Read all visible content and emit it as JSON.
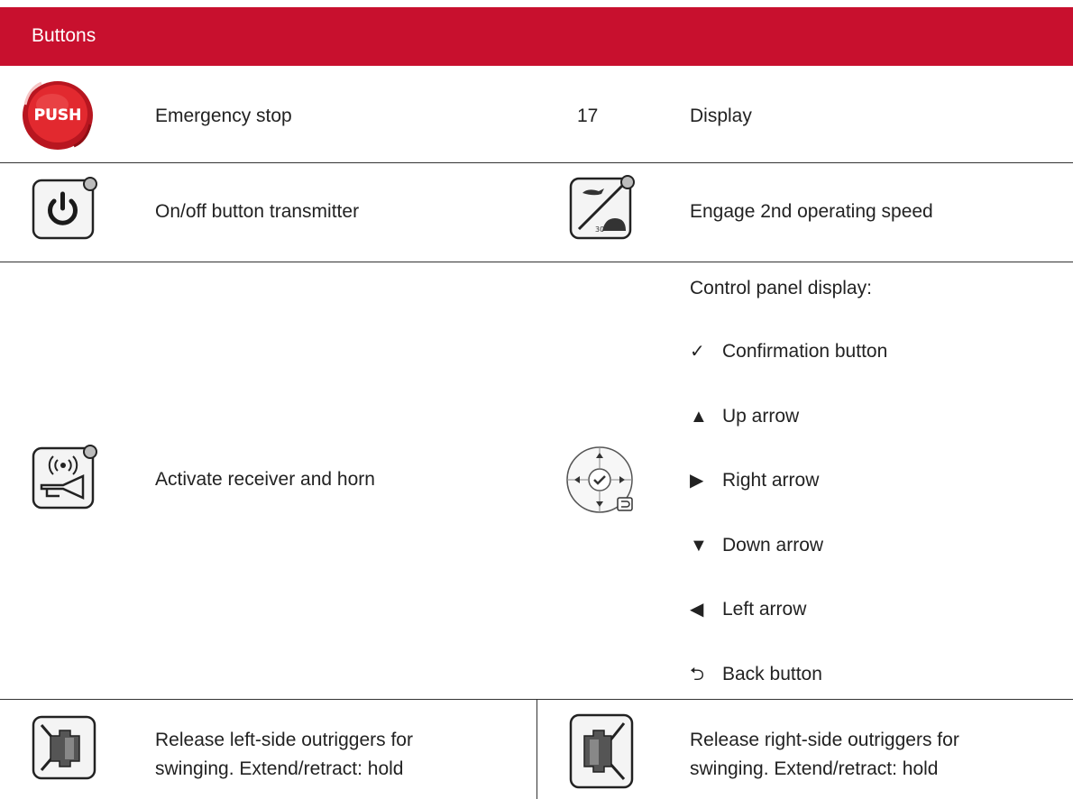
{
  "header": {
    "title": "Buttons"
  },
  "rows": {
    "r1": {
      "left_label": "Emergency stop",
      "push_text": "PUSH",
      "right_number": "17",
      "right_label": "Display"
    },
    "r2": {
      "left_label": "On/off button transmitter",
      "right_label": "Engage 2nd operating speed"
    },
    "r3": {
      "left_label": "Activate receiver and horn",
      "panel_title": "Control panel display:",
      "items": [
        {
          "icon": "✓",
          "icon_name": "check-icon",
          "label": "Confirmation button"
        },
        {
          "icon": "▲",
          "icon_name": "up-arrow-icon",
          "label": "Up arrow"
        },
        {
          "icon": "▶",
          "icon_name": "right-arrow-icon",
          "label": "Right arrow"
        },
        {
          "icon": "▼",
          "icon_name": "down-arrow-icon",
          "label": "Down arrow"
        },
        {
          "icon": "◀",
          "icon_name": "left-arrow-icon",
          "label": "Left arrow"
        },
        {
          "icon": "⮌",
          "icon_name": "back-icon",
          "label": "Back button"
        }
      ]
    },
    "r4": {
      "left_label_1": "Release left-side outriggers for",
      "left_label_2": "swinging.  Extend/retract: hold",
      "right_label_1": "Release right-side outriggers for",
      "right_label_2": "swinging.  Extend/retract: hold"
    }
  },
  "colors": {
    "header_bg": "#c8102e",
    "estop_red": "#d8202a"
  }
}
